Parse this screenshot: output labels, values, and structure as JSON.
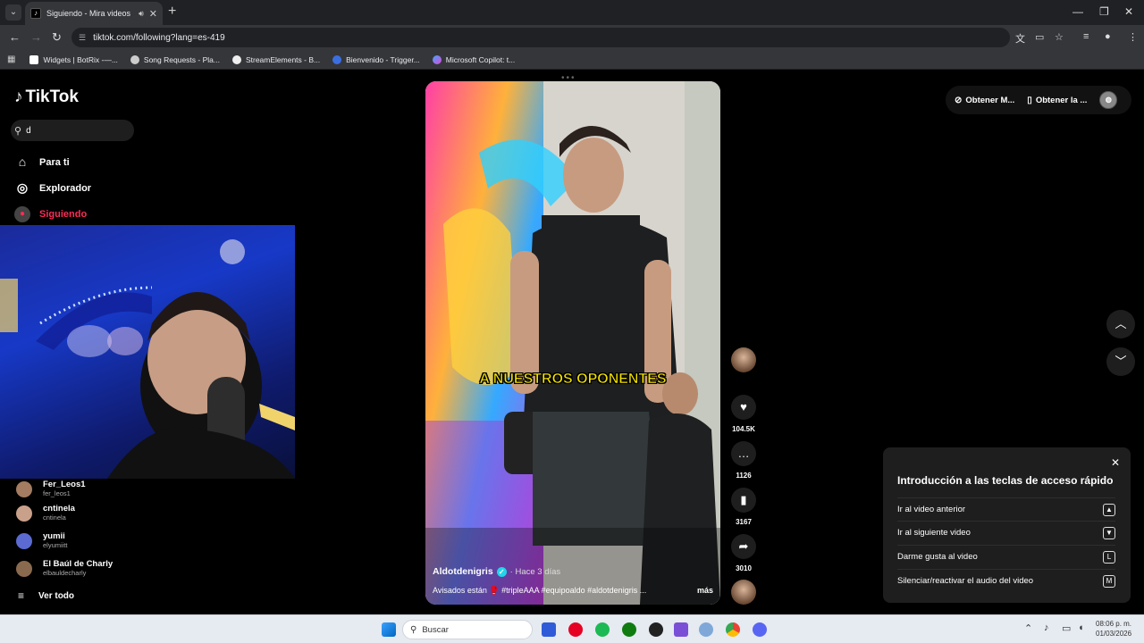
{
  "browser": {
    "tab_title": "Siguiendo - Mira videos pu",
    "url": "tiktok.com/following?lang=es-419",
    "bookmarks": [
      {
        "label": "Widgets | BotRix -—..."
      },
      {
        "label": "Song Requests - Pla..."
      },
      {
        "label": "StreamElements - B..."
      },
      {
        "label": "Bienvenido - Trigger..."
      },
      {
        "label": "Microsoft Copilot: t..."
      }
    ]
  },
  "sidebar": {
    "logo": "TikTok",
    "search_value": "d",
    "nav": [
      {
        "label": "Para ti"
      },
      {
        "label": "Explorador"
      },
      {
        "label": "Siguiendo"
      }
    ],
    "following": [
      {
        "name": "Fer_Leos1",
        "handle": "fer_leos1"
      },
      {
        "name": "cntinela",
        "handle": "cntinela"
      },
      {
        "name": "yumii",
        "handle": "elyumiitt"
      },
      {
        "name": "El Baúl de Charly",
        "handle": "elbauldecharly"
      }
    ],
    "see_all": "Ver todo"
  },
  "video": {
    "caption": "A NUESTROS OPONENTES",
    "author": "Aldotdenigris",
    "date": "· Hace 3 días",
    "description": "Avisados están 🥊 #tripleAAA #equipoaldo #aldotdenigris ...",
    "more": "más"
  },
  "actions": {
    "likes": "104.5K",
    "comments": "1126",
    "saves": "3167",
    "shares": "3010"
  },
  "topbar": {
    "btn1": "Obtener M...",
    "btn2": "Obtener la ..."
  },
  "shortcuts": {
    "title": "Introducción a las teclas de acceso rápido",
    "items": [
      {
        "label": "Ir al video anterior",
        "key": "▲"
      },
      {
        "label": "Ir al siguiente video",
        "key": "▼"
      },
      {
        "label": "Darme gusta al video",
        "key": "L"
      },
      {
        "label": "Silenciar/reactivar el audio del video",
        "key": "M"
      }
    ]
  },
  "taskbar": {
    "search_placeholder": "Buscar",
    "time": "08:06 p. m.",
    "date": "01/03/2026"
  }
}
